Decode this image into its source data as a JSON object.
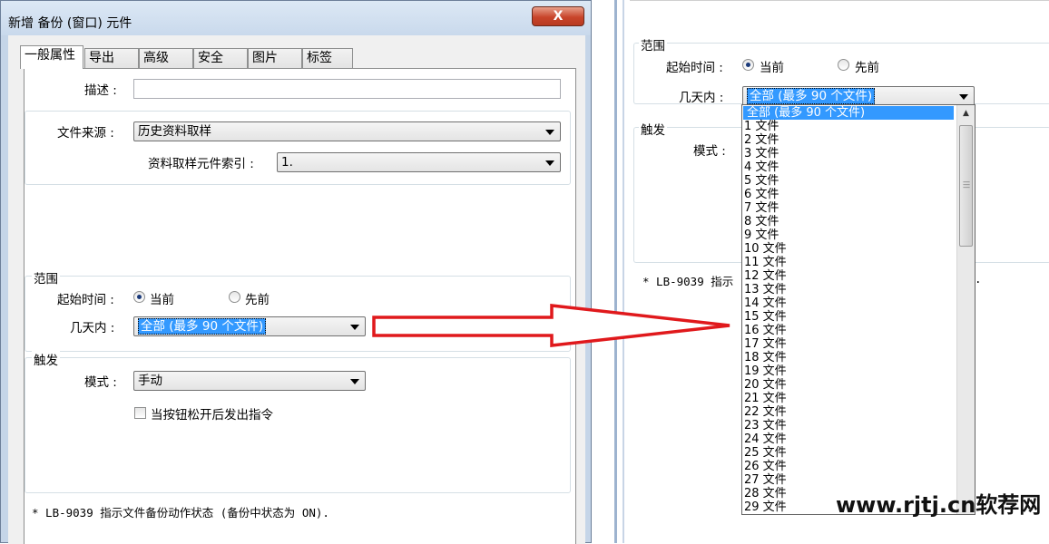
{
  "window": {
    "title": "新增 备份 (窗口) 元件",
    "close_label": "X"
  },
  "tabs": [
    {
      "label": "一般属性",
      "active": true
    },
    {
      "label": "导出"
    },
    {
      "label": "高级"
    },
    {
      "label": "安全"
    },
    {
      "label": "图片"
    },
    {
      "label": "标签"
    }
  ],
  "general": {
    "description_label": "描述 :",
    "description_value": "",
    "file_source_label": "文件来源 :",
    "file_source_value": "历史资料取样",
    "sample_index_label": "资料取样元件索引 :",
    "sample_index_value": "1."
  },
  "range": {
    "title": "范围",
    "start_time_label": "起始时间 :",
    "radio_current": "当前",
    "radio_previous": "先前",
    "selected_radio": "当前",
    "days_label": "几天内 :",
    "days_value": "全部 (最多 90 个文件)"
  },
  "trigger": {
    "title": "触发",
    "mode_label": "模式 :",
    "mode_value": "手动",
    "checkbox_label": "当按钮松开后发出指令",
    "checkbox_checked": false
  },
  "note": "* LB-9039 指示文件备份动作状态 (备份中状态为 ON).",
  "right_panel": {
    "range_title": "范围",
    "start_time_label": "起始时间 :",
    "radio_current": "当前",
    "radio_previous": "先前",
    "days_label": "几天内 :",
    "days_value": "全部 (最多 90 个文件)",
    "trigger_title": "触发",
    "mode_label": "模式 :",
    "note_partial_left": "* LB-9039 指示",
    "note_partial_right": ".",
    "dropdown_options": [
      "全部 (最多 90 个文件)",
      "1 文件",
      "2 文件",
      "3 文件",
      "4 文件",
      "5 文件",
      "6 文件",
      "7 文件",
      "8 文件",
      "9 文件",
      "10 文件",
      "11 文件",
      "12 文件",
      "13 文件",
      "14 文件",
      "15 文件",
      "16 文件",
      "17 文件",
      "18 文件",
      "19 文件",
      "20 文件",
      "21 文件",
      "22 文件",
      "23 文件",
      "24 文件",
      "25 文件",
      "26 文件",
      "27 文件",
      "28 文件",
      "29 文件"
    ],
    "selected_option_index": 0
  },
  "annotation": {
    "arrow_color": "#e0191c"
  },
  "watermark": "www.rjtj.cn软荐网"
}
